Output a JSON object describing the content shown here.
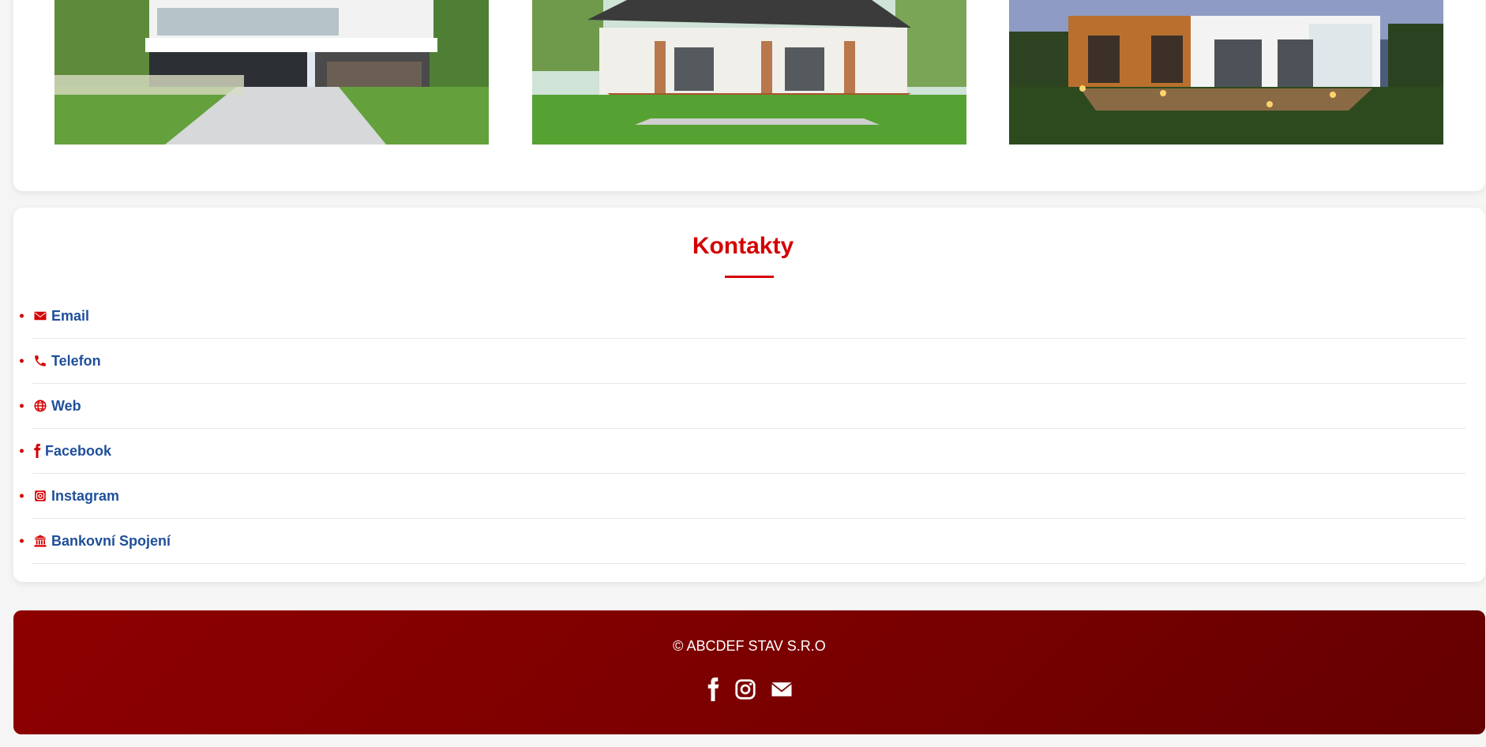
{
  "gallery": {
    "images": [
      {
        "icon": "modern-villa-image"
      },
      {
        "icon": "bungalow-terrace-image"
      },
      {
        "icon": "night-house-image"
      }
    ]
  },
  "contacts": {
    "title": "Kontakty",
    "items": [
      {
        "label": "Email",
        "icon": "envelope-icon"
      },
      {
        "label": "Telefon",
        "icon": "phone-icon"
      },
      {
        "label": "Web",
        "icon": "globe-icon"
      },
      {
        "label": "Facebook",
        "icon": "facebook-icon"
      },
      {
        "label": "Instagram",
        "icon": "instagram-icon"
      },
      {
        "label": "Bankovní Spojení",
        "icon": "bank-icon"
      }
    ]
  },
  "footer": {
    "copyright": "© ABCDEF STAV S.R.O",
    "social": [
      "facebook-icon",
      "instagram-icon",
      "envelope-icon"
    ]
  },
  "colors": {
    "accent": "#d40000",
    "link": "#1f4f9a",
    "footer_start": "#8e0000",
    "footer_end": "#640000"
  }
}
